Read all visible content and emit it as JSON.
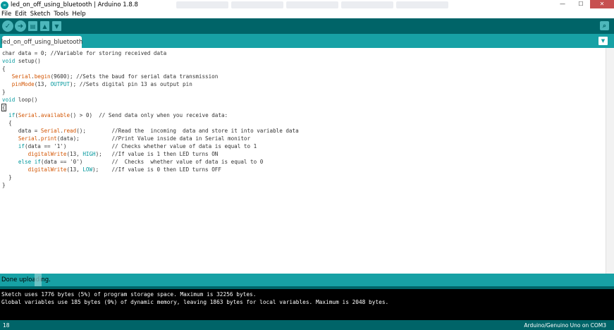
{
  "window": {
    "title": "led_on_off_using_bluetooth | Arduino 1.8.8",
    "app_icon_text": "∞",
    "min_label": "—",
    "max_label": "☐",
    "close_label": "✕"
  },
  "menu": [
    "File",
    "Edit",
    "Sketch",
    "Tools",
    "Help"
  ],
  "toolbar": {
    "verify_glyph": "✓",
    "upload_glyph": "➜",
    "new_glyph": "▤",
    "open_glyph": "▲",
    "save_glyph": "▼",
    "serial_glyph": "⌕"
  },
  "tabs": {
    "active": "led_on_off_using_bluetooth",
    "menu_glyph": "▼"
  },
  "editor": {
    "lines": [
      [
        [
          "char data = 0; //Variable for storing received data",
          ""
        ]
      ],
      [
        [
          "void",
          "kw"
        ],
        [
          " setup()",
          ""
        ]
      ],
      [
        [
          "{",
          ""
        ]
      ],
      [
        [
          "   ",
          ""
        ],
        [
          "Serial",
          "fn"
        ],
        [
          ".",
          ""
        ],
        [
          "begin",
          "fn"
        ],
        [
          "(9600); //Sets the baud for serial data transmission",
          ""
        ]
      ],
      [
        [
          "   ",
          ""
        ],
        [
          "pinMode",
          "fn"
        ],
        [
          "(13, ",
          ""
        ],
        [
          "OUTPUT",
          "kw"
        ],
        [
          "); //Sets digital pin 13 as output pin",
          ""
        ]
      ],
      [
        [
          "}",
          ""
        ]
      ],
      [
        [
          "void",
          "kw"
        ],
        [
          " loop()",
          ""
        ]
      ],
      [
        [
          "{",
          ""
        ]
      ],
      [
        [
          "  ",
          ""
        ],
        [
          "if",
          "kw"
        ],
        [
          "(",
          ""
        ],
        [
          "Serial",
          "fn"
        ],
        [
          ".",
          ""
        ],
        [
          "available",
          "fn"
        ],
        [
          "() > 0)  // Send data only when you receive data:",
          ""
        ]
      ],
      [
        [
          "  {",
          ""
        ]
      ],
      [
        [
          "     data = ",
          ""
        ],
        [
          "Serial",
          "fn"
        ],
        [
          ".",
          ""
        ],
        [
          "read",
          "fn"
        ],
        [
          "();        //Read the  incoming  data and store it into variable data",
          ""
        ]
      ],
      [
        [
          "     ",
          ""
        ],
        [
          "Serial",
          "fn"
        ],
        [
          ".",
          ""
        ],
        [
          "print",
          "fn"
        ],
        [
          "(data);          //Print Value inside data in Serial monitor",
          ""
        ]
      ],
      [
        [
          "     ",
          ""
        ],
        [
          "if",
          "kw"
        ],
        [
          "(data == '1')              // Checks whether value of data is equal to 1",
          ""
        ]
      ],
      [
        [
          "        ",
          ""
        ],
        [
          "digitalWrite",
          "fn"
        ],
        [
          "(13, ",
          ""
        ],
        [
          "HIGH",
          "kw"
        ],
        [
          ");   //If value is 1 then LED turns ON",
          ""
        ]
      ],
      [
        [
          "     ",
          ""
        ],
        [
          "else",
          "kw"
        ],
        [
          " ",
          ""
        ],
        [
          "if",
          "kw"
        ],
        [
          "(data == '0')         //  Checks  whether value of data is equal to 0",
          ""
        ]
      ],
      [
        [
          "        ",
          ""
        ],
        [
          "digitalWrite",
          "fn"
        ],
        [
          "(13, ",
          ""
        ],
        [
          "LOW",
          "kw"
        ],
        [
          ");    //If value is 0 then LED turns OFF",
          ""
        ]
      ],
      [
        [
          "  }",
          ""
        ]
      ],
      [
        [
          "}",
          ""
        ]
      ]
    ]
  },
  "status": {
    "message": "Done uploading."
  },
  "console": {
    "lines": [
      "Sketch uses 1776 bytes (5%) of program storage space. Maximum is 32256 bytes.",
      "Global variables use 185 bytes (9%) of dynamic memory, leaving 1863 bytes for local variables. Maximum is 2048 bytes."
    ]
  },
  "footer": {
    "line_number": "18",
    "board": "Arduino/Genuino Uno on COM3"
  },
  "colors": {
    "toolbar": "#006468",
    "tabstrip": "#17a1a5",
    "button": "#4db7bb",
    "keyword": "#00979c",
    "function": "#d35400",
    "console_bg": "#000000"
  }
}
